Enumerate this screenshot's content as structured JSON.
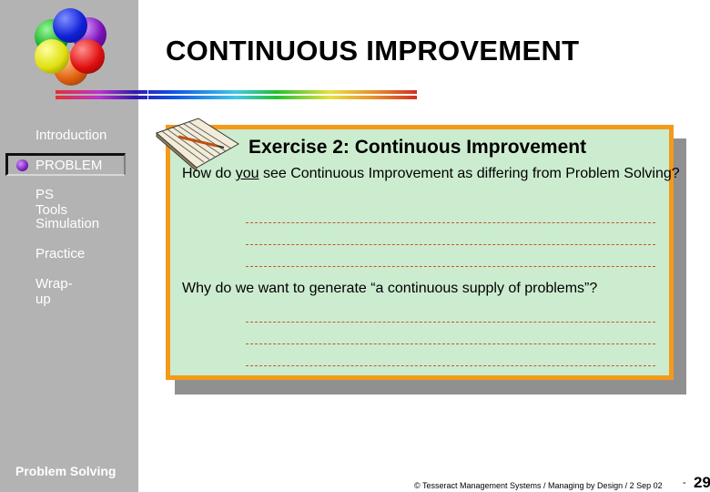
{
  "slide": {
    "title": "CONTINUOUS IMPROVEMENT",
    "page_number": "29",
    "page_separator": "-",
    "footer_copyright": "© Tesseract Management Systems / Managing by Design / 2 Sep 02",
    "footer_section": "Problem Solving"
  },
  "sidebar": {
    "items": [
      {
        "label": "Introduction",
        "active": false
      },
      {
        "label": "PROBLEM",
        "active": true
      },
      {
        "label": "PS Tools",
        "active": false
      },
      {
        "label": "Simulation",
        "active": false
      },
      {
        "label": "Practice",
        "active": false
      },
      {
        "label": "Wrap-up",
        "active": false
      }
    ]
  },
  "exercise": {
    "title": "Exercise 2: Continuous Improvement",
    "question1_pre": "How do ",
    "question1_emph": "you",
    "question1_post": " see Continuous Improvement as differing from Problem Solving?",
    "question2": "Why do we want to generate “a continuous supply of problems”?",
    "answer_lines_per_question": 3
  },
  "colors": {
    "sidebar_bg": "#b3b3b3",
    "card_bg": "#ccecd0",
    "card_border": "#f49a18",
    "dash": "#c05a28"
  },
  "logo": {
    "balls": [
      "green",
      "blue",
      "purple",
      "orange",
      "yellow",
      "red"
    ]
  }
}
